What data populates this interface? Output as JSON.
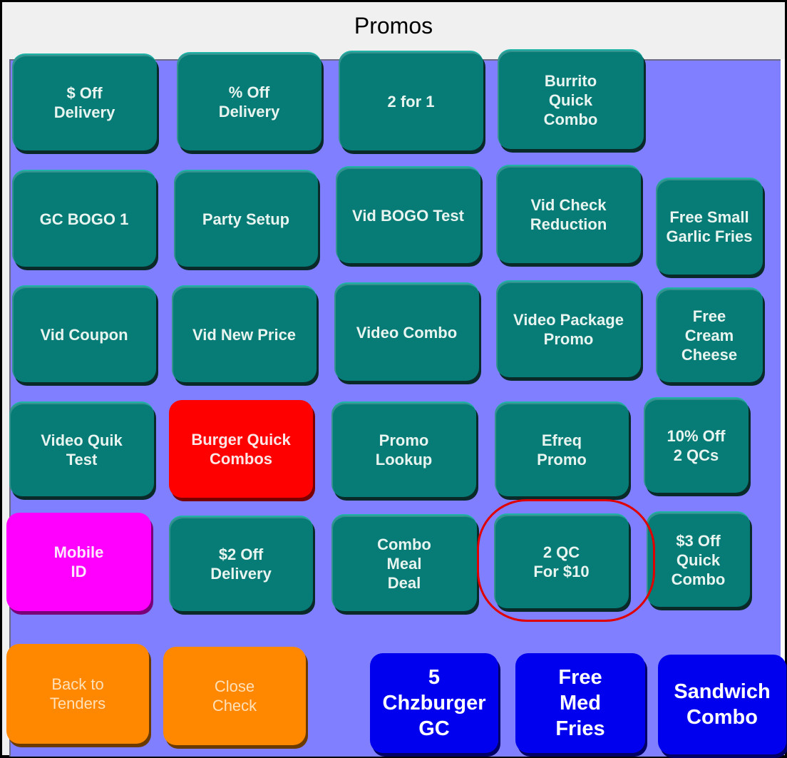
{
  "window": {
    "title": "Promos"
  },
  "colors": {
    "panel_background": "#7f7fff",
    "promo_button": "#077b76",
    "selected_group_button": "#ff0000",
    "mobile_button": "#ff00ff",
    "navigation_button": "#ff8800",
    "quick_button": "#0000ee",
    "annotation_circle": "#e00000"
  },
  "promo_buttons": [
    {
      "label": "$ Off\nDelivery"
    },
    {
      "label": "% Off\nDelivery"
    },
    {
      "label": "2 for 1"
    },
    {
      "label": "Burrito\nQuick\nCombo"
    },
    {
      "label": "GC BOGO 1"
    },
    {
      "label": "Party Setup"
    },
    {
      "label": "Vid BOGO Test"
    },
    {
      "label": "Vid Check\nReduction"
    },
    {
      "label": "Free Small\nGarlic Fries"
    },
    {
      "label": "Vid Coupon"
    },
    {
      "label": "Vid New Price"
    },
    {
      "label": "Video Combo"
    },
    {
      "label": "Video Package\nPromo"
    },
    {
      "label": "Free\nCream\nCheese"
    },
    {
      "label": "Video Quik\nTest"
    },
    {
      "label": "Burger Quick\nCombos"
    },
    {
      "label": "Promo\nLookup"
    },
    {
      "label": "Efreq\nPromo"
    },
    {
      "label": "10% Off\n2 QCs"
    },
    {
      "label": "Mobile\nID"
    },
    {
      "label": "$2 Off\nDelivery"
    },
    {
      "label": "Combo\nMeal\nDeal"
    },
    {
      "label": "2 QC\nFor $10",
      "highlighted": true
    },
    {
      "label": "$3 Off\nQuick\nCombo"
    }
  ],
  "navigation_buttons": [
    {
      "label": "Back to\nTenders"
    },
    {
      "label": "Close\nCheck"
    }
  ],
  "quick_buttons": [
    {
      "label": "5\nChzburger\nGC"
    },
    {
      "label": "Free\nMed\nFries"
    },
    {
      "label": "Sandwich\nCombo"
    }
  ]
}
